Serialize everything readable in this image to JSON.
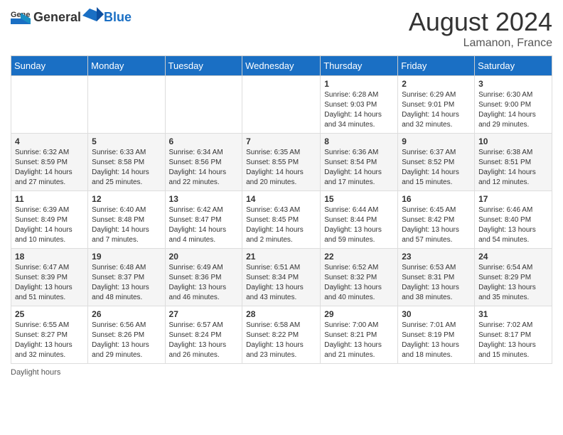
{
  "header": {
    "logo_general": "General",
    "logo_blue": "Blue",
    "month_year": "August 2024",
    "location": "Lamanon, France"
  },
  "days_of_week": [
    "Sunday",
    "Monday",
    "Tuesday",
    "Wednesday",
    "Thursday",
    "Friday",
    "Saturday"
  ],
  "weeks": [
    [
      {
        "day": "",
        "info": ""
      },
      {
        "day": "",
        "info": ""
      },
      {
        "day": "",
        "info": ""
      },
      {
        "day": "",
        "info": ""
      },
      {
        "day": "1",
        "info": "Sunrise: 6:28 AM\nSunset: 9:03 PM\nDaylight: 14 hours and 34 minutes."
      },
      {
        "day": "2",
        "info": "Sunrise: 6:29 AM\nSunset: 9:01 PM\nDaylight: 14 hours and 32 minutes."
      },
      {
        "day": "3",
        "info": "Sunrise: 6:30 AM\nSunset: 9:00 PM\nDaylight: 14 hours and 29 minutes."
      }
    ],
    [
      {
        "day": "4",
        "info": "Sunrise: 6:32 AM\nSunset: 8:59 PM\nDaylight: 14 hours and 27 minutes."
      },
      {
        "day": "5",
        "info": "Sunrise: 6:33 AM\nSunset: 8:58 PM\nDaylight: 14 hours and 25 minutes."
      },
      {
        "day": "6",
        "info": "Sunrise: 6:34 AM\nSunset: 8:56 PM\nDaylight: 14 hours and 22 minutes."
      },
      {
        "day": "7",
        "info": "Sunrise: 6:35 AM\nSunset: 8:55 PM\nDaylight: 14 hours and 20 minutes."
      },
      {
        "day": "8",
        "info": "Sunrise: 6:36 AM\nSunset: 8:54 PM\nDaylight: 14 hours and 17 minutes."
      },
      {
        "day": "9",
        "info": "Sunrise: 6:37 AM\nSunset: 8:52 PM\nDaylight: 14 hours and 15 minutes."
      },
      {
        "day": "10",
        "info": "Sunrise: 6:38 AM\nSunset: 8:51 PM\nDaylight: 14 hours and 12 minutes."
      }
    ],
    [
      {
        "day": "11",
        "info": "Sunrise: 6:39 AM\nSunset: 8:49 PM\nDaylight: 14 hours and 10 minutes."
      },
      {
        "day": "12",
        "info": "Sunrise: 6:40 AM\nSunset: 8:48 PM\nDaylight: 14 hours and 7 minutes."
      },
      {
        "day": "13",
        "info": "Sunrise: 6:42 AM\nSunset: 8:47 PM\nDaylight: 14 hours and 4 minutes."
      },
      {
        "day": "14",
        "info": "Sunrise: 6:43 AM\nSunset: 8:45 PM\nDaylight: 14 hours and 2 minutes."
      },
      {
        "day": "15",
        "info": "Sunrise: 6:44 AM\nSunset: 8:44 PM\nDaylight: 13 hours and 59 minutes."
      },
      {
        "day": "16",
        "info": "Sunrise: 6:45 AM\nSunset: 8:42 PM\nDaylight: 13 hours and 57 minutes."
      },
      {
        "day": "17",
        "info": "Sunrise: 6:46 AM\nSunset: 8:40 PM\nDaylight: 13 hours and 54 minutes."
      }
    ],
    [
      {
        "day": "18",
        "info": "Sunrise: 6:47 AM\nSunset: 8:39 PM\nDaylight: 13 hours and 51 minutes."
      },
      {
        "day": "19",
        "info": "Sunrise: 6:48 AM\nSunset: 8:37 PM\nDaylight: 13 hours and 48 minutes."
      },
      {
        "day": "20",
        "info": "Sunrise: 6:49 AM\nSunset: 8:36 PM\nDaylight: 13 hours and 46 minutes."
      },
      {
        "day": "21",
        "info": "Sunrise: 6:51 AM\nSunset: 8:34 PM\nDaylight: 13 hours and 43 minutes."
      },
      {
        "day": "22",
        "info": "Sunrise: 6:52 AM\nSunset: 8:32 PM\nDaylight: 13 hours and 40 minutes."
      },
      {
        "day": "23",
        "info": "Sunrise: 6:53 AM\nSunset: 8:31 PM\nDaylight: 13 hours and 38 minutes."
      },
      {
        "day": "24",
        "info": "Sunrise: 6:54 AM\nSunset: 8:29 PM\nDaylight: 13 hours and 35 minutes."
      }
    ],
    [
      {
        "day": "25",
        "info": "Sunrise: 6:55 AM\nSunset: 8:27 PM\nDaylight: 13 hours and 32 minutes."
      },
      {
        "day": "26",
        "info": "Sunrise: 6:56 AM\nSunset: 8:26 PM\nDaylight: 13 hours and 29 minutes."
      },
      {
        "day": "27",
        "info": "Sunrise: 6:57 AM\nSunset: 8:24 PM\nDaylight: 13 hours and 26 minutes."
      },
      {
        "day": "28",
        "info": "Sunrise: 6:58 AM\nSunset: 8:22 PM\nDaylight: 13 hours and 23 minutes."
      },
      {
        "day": "29",
        "info": "Sunrise: 7:00 AM\nSunset: 8:21 PM\nDaylight: 13 hours and 21 minutes."
      },
      {
        "day": "30",
        "info": "Sunrise: 7:01 AM\nSunset: 8:19 PM\nDaylight: 13 hours and 18 minutes."
      },
      {
        "day": "31",
        "info": "Sunrise: 7:02 AM\nSunset: 8:17 PM\nDaylight: 13 hours and 15 minutes."
      }
    ]
  ],
  "footer": {
    "daylight_hours_label": "Daylight hours"
  }
}
